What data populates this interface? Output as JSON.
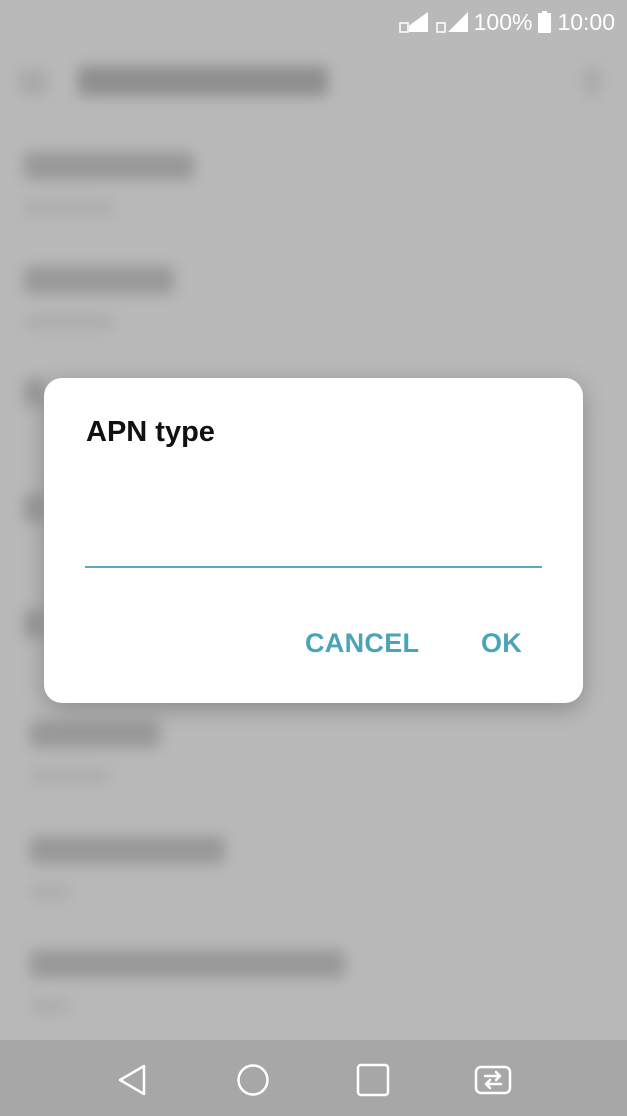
{
  "status_bar": {
    "battery_percent": "100%",
    "time": "10:00",
    "sim1_label": "1",
    "sim2_label": "2"
  },
  "dialog": {
    "title": "APN type",
    "input_value": "",
    "cancel_label": "CANCEL",
    "ok_label": "OK"
  },
  "nav_bar": {
    "icons": [
      "back-icon",
      "home-icon",
      "recents-icon",
      "dual-window-icon"
    ]
  },
  "colors": {
    "accent": "#4aa3b9",
    "dim_background": "#b9b9b9",
    "dialog_background": "#ffffff"
  }
}
